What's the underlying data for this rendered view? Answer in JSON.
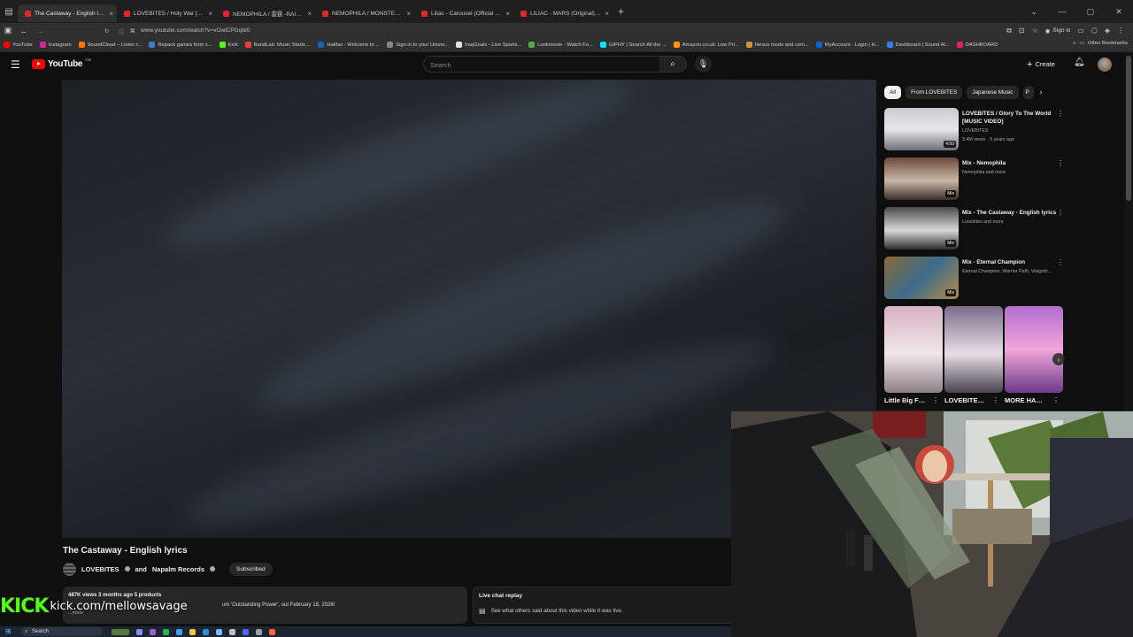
{
  "browser": {
    "tabs": [
      {
        "title": "The Castaway - English lyrics",
        "active": true
      },
      {
        "title": "LOVEBITES / Holy War [Live at Z"
      },
      {
        "title": "NEMOPHILA / 雷霆 -RAITEI- [O"
      },
      {
        "title": "NEMOPHILA / MONSTERS [Offi"
      },
      {
        "title": "Liliac - Carousel (Official Music"
      },
      {
        "title": "LILIAC - MARS (Original) [Live a"
      }
    ],
    "url": "www.youtube.com/watch?v=vOwlCPGqbI0",
    "sign_in": "Sign in",
    "bookmarks": [
      {
        "label": "YouTube",
        "color": "#ff0000"
      },
      {
        "label": "Instagram",
        "color": "#d6249f"
      },
      {
        "label": "SoundCloud – Listen t...",
        "color": "#ff7700"
      },
      {
        "label": "Repack games from x...",
        "color": "#3a7bd5"
      },
      {
        "label": "Kick",
        "color": "#53fc18"
      },
      {
        "label": "BandLab: Music Starts ...",
        "color": "#f23b3b"
      },
      {
        "label": "Halifax - Welcome to ...",
        "color": "#1b5fbf"
      },
      {
        "label": "Sign in to your Univer...",
        "color": "#888888"
      },
      {
        "label": "IraqGoals - Live Sports...",
        "color": "#e0e0e0"
      },
      {
        "label": "Lookmovie - Watch Fo...",
        "color": "#4caf50"
      },
      {
        "label": "GIPHY | Search All the ...",
        "color": "#00e6ff"
      },
      {
        "label": "Amazon.co.uk: Low Pri...",
        "color": "#ff9900"
      },
      {
        "label": "Nexus mods and com...",
        "color": "#da8e35"
      },
      {
        "label": "MyAccount - Login | H...",
        "color": "#0066cc"
      },
      {
        "label": "Dashboard | Sound Al...",
        "color": "#2f80ed"
      },
      {
        "label": "DASHBOARD",
        "color": "#e0245e"
      }
    ],
    "other_bookmarks": "Other Bookmarks"
  },
  "youtube": {
    "logo": "YouTube",
    "country_code": "GB",
    "search_placeholder": "Search",
    "create_label": "Create",
    "video_title": "The Castaway - English lyrics",
    "channel": "LOVEBITES",
    "channel_and": "and",
    "channel2": "Napalm Records",
    "subscribed": "Subscribed",
    "desc_meta": "487K views  3 months ago  5 products",
    "desc_text": "um 'Outstanding Power', out February 18, 2026!",
    "desc_more": "...more",
    "live_chat_title": "Live chat replay",
    "live_chat_text": "See what others said about this video while it was live.",
    "chips": [
      "All",
      "From LOVEBITES",
      "Japanese Music",
      "P"
    ],
    "recommendations": [
      {
        "title": "LOVEBITES / Glory To The World [MUSIC VIDEO]",
        "sub1": "LOVEBITES",
        "sub2": "3.4M views · 5 years ago",
        "badge": "4:50"
      },
      {
        "title": "Mix - Nemophila",
        "sub1": "Nemophila and more",
        "sub2": "",
        "badge": "Mix"
      },
      {
        "title": "Mix - The Castaway - English lyrics",
        "sub1": "Lovebites and more",
        "sub2": "",
        "badge": "Mix"
      },
      {
        "title": "Mix - Eternal Champion",
        "sub1": "Eternal Champion, Warrior Path, Visigoth...",
        "sub2": "",
        "badge": "Mix"
      }
    ],
    "shorts": [
      {
        "label": "Little Big Fuyuhara..."
      },
      {
        "label": "LOVEBITES / Soldiers..."
      },
      {
        "label": "MORE HADUKI IN..."
      }
    ]
  },
  "overlay": {
    "kick_logo": "KICK",
    "kick_url": "kick.com/mellowsavage"
  },
  "taskbar": {
    "search_label": "Search"
  }
}
